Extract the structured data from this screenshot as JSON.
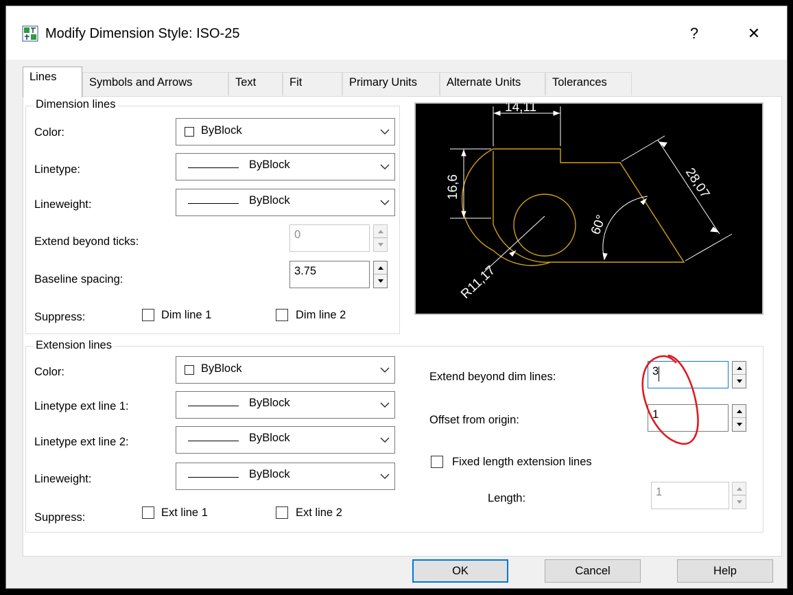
{
  "window": {
    "title": "Modify Dimension Style: ISO-25",
    "help_label": "?",
    "close_label": "✕"
  },
  "tabs": [
    {
      "label": "Lines",
      "active": true
    },
    {
      "label": "Symbols and Arrows"
    },
    {
      "label": "Text"
    },
    {
      "label": "Fit"
    },
    {
      "label": "Primary Units"
    },
    {
      "label": "Alternate Units"
    },
    {
      "label": "Tolerances"
    }
  ],
  "dimension_lines": {
    "title": "Dimension lines",
    "color_label": "Color:",
    "color_value": "ByBlock",
    "linetype_label": "Linetype:",
    "linetype_value": "ByBlock",
    "lineweight_label": "Lineweight:",
    "lineweight_value": "ByBlock",
    "extend_label": "Extend beyond ticks:",
    "extend_value": "0",
    "baseline_label": "Baseline spacing:",
    "baseline_value": "3.75",
    "suppress_label": "Suppress:",
    "dim_line_1": "Dim line 1",
    "dim_line_2": "Dim line 2"
  },
  "preview": {
    "dim_top": "14,11",
    "dim_left": "16,6",
    "dim_diag": "28,07",
    "dim_angle": "60°",
    "dim_radius": "R11,17",
    "geometry_color": "#d4a017",
    "dimension_color": "#ffffff"
  },
  "extension_lines": {
    "title": "Extension lines",
    "color_label": "Color:",
    "color_value": "ByBlock",
    "lt1_label": "Linetype ext line 1:",
    "lt1_value": "ByBlock",
    "lt2_label": "Linetype ext line 2:",
    "lt2_value": "ByBlock",
    "lineweight_label": "Lineweight:",
    "lineweight_value": "ByBlock",
    "suppress_label": "Suppress:",
    "ext_line_1": "Ext line 1",
    "ext_line_2": "Ext line 2",
    "extend_beyond_label": "Extend beyond dim lines:",
    "extend_beyond_value": "3",
    "offset_label": "Offset from origin:",
    "offset_value": "1",
    "fixed_length_label": "Fixed length extension lines",
    "length_label": "Length:",
    "length_value": "1"
  },
  "buttons": {
    "ok": "OK",
    "cancel": "Cancel",
    "help": "Help"
  },
  "annotation": {
    "color": "#e0191e"
  }
}
